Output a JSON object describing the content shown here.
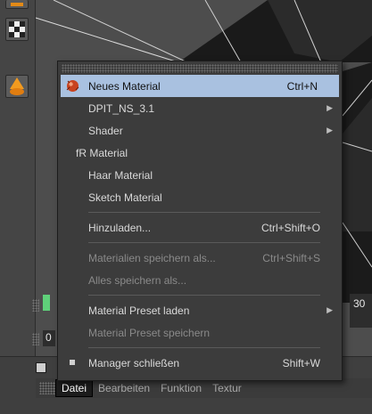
{
  "menu": {
    "items": [
      {
        "label": "Neues Material",
        "shortcut": "Ctrl+N",
        "icon": "material-sphere-icon",
        "selected": true
      },
      {
        "label": "DPIT_NS_3.1",
        "submenu": true
      },
      {
        "label": "Shader",
        "submenu": true
      },
      {
        "label": "fR Material"
      },
      {
        "label": "Haar Material"
      },
      {
        "label": "Sketch Material"
      },
      {
        "label": "Hinzuladen...",
        "shortcut": "Ctrl+Shift+O"
      },
      {
        "label": "Materialien speichern als...",
        "shortcut": "Ctrl+Shift+S",
        "disabled": true
      },
      {
        "label": "Alles speichern als...",
        "disabled": true
      },
      {
        "label": "Material Preset laden",
        "submenu": true
      },
      {
        "label": "Material Preset speichern",
        "disabled": true
      },
      {
        "label": "Manager schließen",
        "shortcut": "Shift+W",
        "checked": true
      }
    ]
  },
  "menubar": {
    "items": [
      "Datei",
      "Bearbeiten",
      "Funktion",
      "Textur"
    ],
    "active": "Datei"
  },
  "timeline": {
    "frame_right": "30",
    "frame_left": "0"
  },
  "colors": {
    "selection": "#a9c1e0",
    "green_marker": "#5fd17a"
  }
}
